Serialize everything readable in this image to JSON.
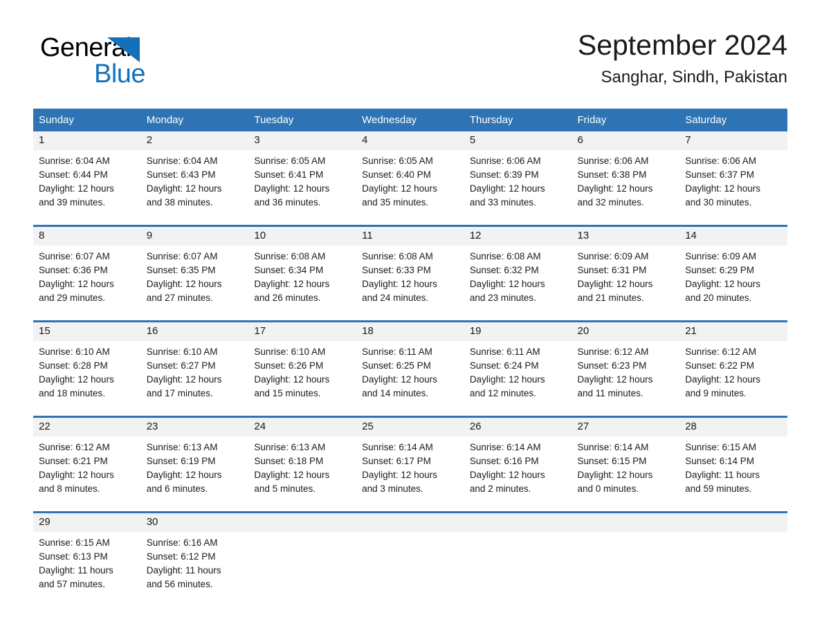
{
  "brand": {
    "name_part1": "General",
    "name_part2": "Blue",
    "accent_color": "#1570b8"
  },
  "header": {
    "title": "September 2024",
    "subtitle": "Sanghar, Sindh, Pakistan"
  },
  "theme": {
    "header_blue": "#2e74b5",
    "daynum_gray": "#f2f2f2",
    "text": "#1a1a1a"
  },
  "weekday_headers": [
    "Sunday",
    "Monday",
    "Tuesday",
    "Wednesday",
    "Thursday",
    "Friday",
    "Saturday"
  ],
  "weeks": [
    [
      {
        "day": "1",
        "sunrise": "Sunrise: 6:04 AM",
        "sunset": "Sunset: 6:44 PM",
        "daylight_line1": "Daylight: 12 hours",
        "daylight_line2": "and 39 minutes."
      },
      {
        "day": "2",
        "sunrise": "Sunrise: 6:04 AM",
        "sunset": "Sunset: 6:43 PM",
        "daylight_line1": "Daylight: 12 hours",
        "daylight_line2": "and 38 minutes."
      },
      {
        "day": "3",
        "sunrise": "Sunrise: 6:05 AM",
        "sunset": "Sunset: 6:41 PM",
        "daylight_line1": "Daylight: 12 hours",
        "daylight_line2": "and 36 minutes."
      },
      {
        "day": "4",
        "sunrise": "Sunrise: 6:05 AM",
        "sunset": "Sunset: 6:40 PM",
        "daylight_line1": "Daylight: 12 hours",
        "daylight_line2": "and 35 minutes."
      },
      {
        "day": "5",
        "sunrise": "Sunrise: 6:06 AM",
        "sunset": "Sunset: 6:39 PM",
        "daylight_line1": "Daylight: 12 hours",
        "daylight_line2": "and 33 minutes."
      },
      {
        "day": "6",
        "sunrise": "Sunrise: 6:06 AM",
        "sunset": "Sunset: 6:38 PM",
        "daylight_line1": "Daylight: 12 hours",
        "daylight_line2": "and 32 minutes."
      },
      {
        "day": "7",
        "sunrise": "Sunrise: 6:06 AM",
        "sunset": "Sunset: 6:37 PM",
        "daylight_line1": "Daylight: 12 hours",
        "daylight_line2": "and 30 minutes."
      }
    ],
    [
      {
        "day": "8",
        "sunrise": "Sunrise: 6:07 AM",
        "sunset": "Sunset: 6:36 PM",
        "daylight_line1": "Daylight: 12 hours",
        "daylight_line2": "and 29 minutes."
      },
      {
        "day": "9",
        "sunrise": "Sunrise: 6:07 AM",
        "sunset": "Sunset: 6:35 PM",
        "daylight_line1": "Daylight: 12 hours",
        "daylight_line2": "and 27 minutes."
      },
      {
        "day": "10",
        "sunrise": "Sunrise: 6:08 AM",
        "sunset": "Sunset: 6:34 PM",
        "daylight_line1": "Daylight: 12 hours",
        "daylight_line2": "and 26 minutes."
      },
      {
        "day": "11",
        "sunrise": "Sunrise: 6:08 AM",
        "sunset": "Sunset: 6:33 PM",
        "daylight_line1": "Daylight: 12 hours",
        "daylight_line2": "and 24 minutes."
      },
      {
        "day": "12",
        "sunrise": "Sunrise: 6:08 AM",
        "sunset": "Sunset: 6:32 PM",
        "daylight_line1": "Daylight: 12 hours",
        "daylight_line2": "and 23 minutes."
      },
      {
        "day": "13",
        "sunrise": "Sunrise: 6:09 AM",
        "sunset": "Sunset: 6:31 PM",
        "daylight_line1": "Daylight: 12 hours",
        "daylight_line2": "and 21 minutes."
      },
      {
        "day": "14",
        "sunrise": "Sunrise: 6:09 AM",
        "sunset": "Sunset: 6:29 PM",
        "daylight_line1": "Daylight: 12 hours",
        "daylight_line2": "and 20 minutes."
      }
    ],
    [
      {
        "day": "15",
        "sunrise": "Sunrise: 6:10 AM",
        "sunset": "Sunset: 6:28 PM",
        "daylight_line1": "Daylight: 12 hours",
        "daylight_line2": "and 18 minutes."
      },
      {
        "day": "16",
        "sunrise": "Sunrise: 6:10 AM",
        "sunset": "Sunset: 6:27 PM",
        "daylight_line1": "Daylight: 12 hours",
        "daylight_line2": "and 17 minutes."
      },
      {
        "day": "17",
        "sunrise": "Sunrise: 6:10 AM",
        "sunset": "Sunset: 6:26 PM",
        "daylight_line1": "Daylight: 12 hours",
        "daylight_line2": "and 15 minutes."
      },
      {
        "day": "18",
        "sunrise": "Sunrise: 6:11 AM",
        "sunset": "Sunset: 6:25 PM",
        "daylight_line1": "Daylight: 12 hours",
        "daylight_line2": "and 14 minutes."
      },
      {
        "day": "19",
        "sunrise": "Sunrise: 6:11 AM",
        "sunset": "Sunset: 6:24 PM",
        "daylight_line1": "Daylight: 12 hours",
        "daylight_line2": "and 12 minutes."
      },
      {
        "day": "20",
        "sunrise": "Sunrise: 6:12 AM",
        "sunset": "Sunset: 6:23 PM",
        "daylight_line1": "Daylight: 12 hours",
        "daylight_line2": "and 11 minutes."
      },
      {
        "day": "21",
        "sunrise": "Sunrise: 6:12 AM",
        "sunset": "Sunset: 6:22 PM",
        "daylight_line1": "Daylight: 12 hours",
        "daylight_line2": "and 9 minutes."
      }
    ],
    [
      {
        "day": "22",
        "sunrise": "Sunrise: 6:12 AM",
        "sunset": "Sunset: 6:21 PM",
        "daylight_line1": "Daylight: 12 hours",
        "daylight_line2": "and 8 minutes."
      },
      {
        "day": "23",
        "sunrise": "Sunrise: 6:13 AM",
        "sunset": "Sunset: 6:19 PM",
        "daylight_line1": "Daylight: 12 hours",
        "daylight_line2": "and 6 minutes."
      },
      {
        "day": "24",
        "sunrise": "Sunrise: 6:13 AM",
        "sunset": "Sunset: 6:18 PM",
        "daylight_line1": "Daylight: 12 hours",
        "daylight_line2": "and 5 minutes."
      },
      {
        "day": "25",
        "sunrise": "Sunrise: 6:14 AM",
        "sunset": "Sunset: 6:17 PM",
        "daylight_line1": "Daylight: 12 hours",
        "daylight_line2": "and 3 minutes."
      },
      {
        "day": "26",
        "sunrise": "Sunrise: 6:14 AM",
        "sunset": "Sunset: 6:16 PM",
        "daylight_line1": "Daylight: 12 hours",
        "daylight_line2": "and 2 minutes."
      },
      {
        "day": "27",
        "sunrise": "Sunrise: 6:14 AM",
        "sunset": "Sunset: 6:15 PM",
        "daylight_line1": "Daylight: 12 hours",
        "daylight_line2": "and 0 minutes."
      },
      {
        "day": "28",
        "sunrise": "Sunrise: 6:15 AM",
        "sunset": "Sunset: 6:14 PM",
        "daylight_line1": "Daylight: 11 hours",
        "daylight_line2": "and 59 minutes."
      }
    ],
    [
      {
        "day": "29",
        "sunrise": "Sunrise: 6:15 AM",
        "sunset": "Sunset: 6:13 PM",
        "daylight_line1": "Daylight: 11 hours",
        "daylight_line2": "and 57 minutes."
      },
      {
        "day": "30",
        "sunrise": "Sunrise: 6:16 AM",
        "sunset": "Sunset: 6:12 PM",
        "daylight_line1": "Daylight: 11 hours",
        "daylight_line2": "and 56 minutes."
      },
      {
        "day": "",
        "sunrise": "",
        "sunset": "",
        "daylight_line1": "",
        "daylight_line2": ""
      },
      {
        "day": "",
        "sunrise": "",
        "sunset": "",
        "daylight_line1": "",
        "daylight_line2": ""
      },
      {
        "day": "",
        "sunrise": "",
        "sunset": "",
        "daylight_line1": "",
        "daylight_line2": ""
      },
      {
        "day": "",
        "sunrise": "",
        "sunset": "",
        "daylight_line1": "",
        "daylight_line2": ""
      },
      {
        "day": "",
        "sunrise": "",
        "sunset": "",
        "daylight_line1": "",
        "daylight_line2": ""
      }
    ]
  ]
}
